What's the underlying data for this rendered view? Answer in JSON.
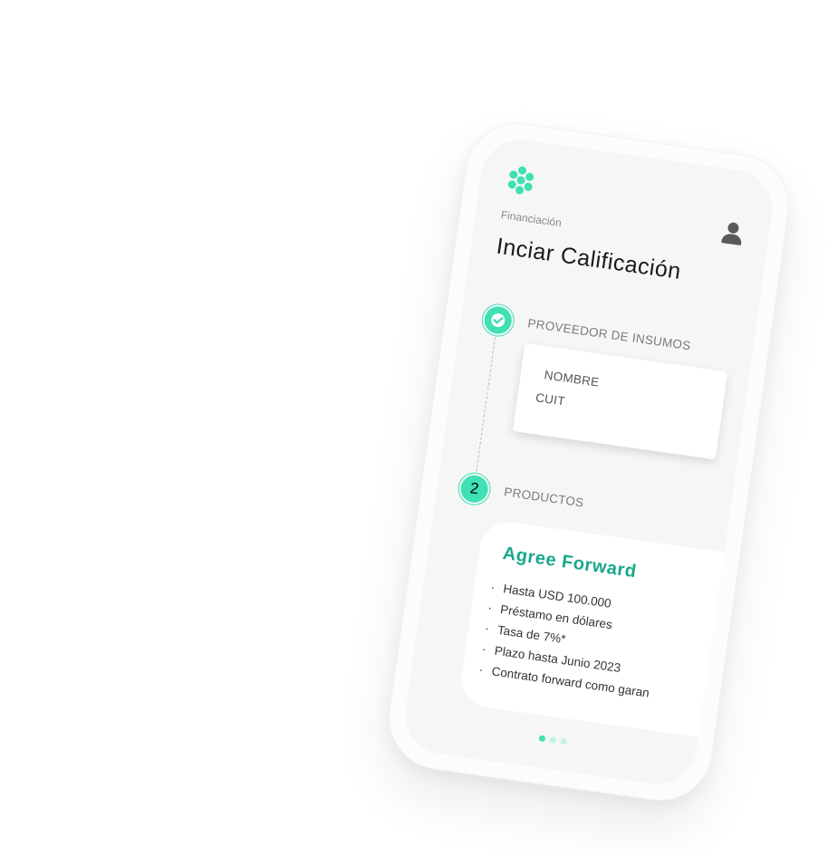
{
  "breadcrumb": "Financiación",
  "page_title": "Inciar Calificación",
  "steps": [
    {
      "number": "",
      "label": "PROVEEDOR DE INSUMOS",
      "fields": [
        "NOMBRE",
        "CUIT"
      ]
    },
    {
      "number": "2",
      "label": "PRODUCTOS"
    }
  ],
  "product": {
    "title": "Agree Forward",
    "bullets": [
      "Hasta USD 100.000",
      "Préstamo en dólares",
      "Tasa de 7%*",
      "Plazo hasta Junio 2023",
      "Contrato forward como garan"
    ]
  },
  "pagination": {
    "total": 3,
    "active": 1
  },
  "colors": {
    "accent": "#3ee0b4",
    "accent_dark": "#18a88a"
  },
  "icons": {
    "logo": "dots-flower-logo",
    "user": "user-icon",
    "check": "check-icon"
  }
}
